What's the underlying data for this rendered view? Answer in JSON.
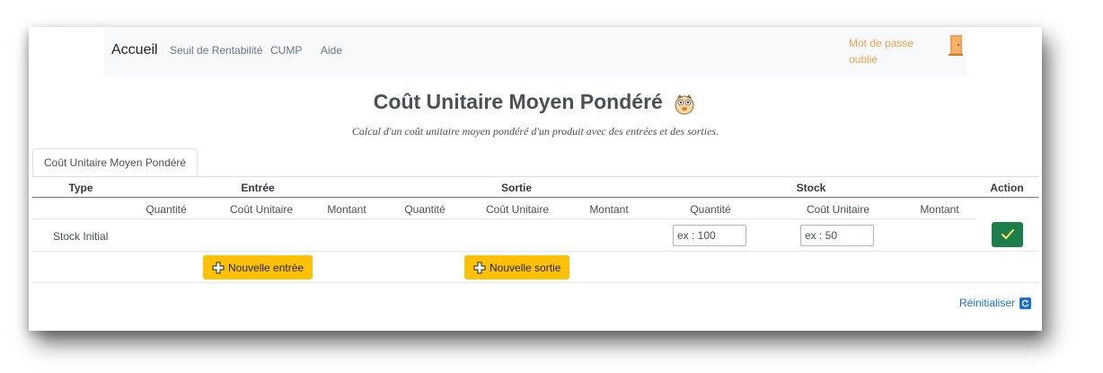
{
  "nav": {
    "brand": "Accueil",
    "links": [
      "Seuil de Rentabilité",
      "CUMP",
      "Aide"
    ],
    "forgot_password": "Mot de passe oublié"
  },
  "page": {
    "title": "Coût Unitaire Moyen Pondéré",
    "subtitle": "Calcul d'un coût unitaire moyen pondéré d'un produit avec des entrées et des sorties.",
    "tab": "Coût Unitaire Moyen Pondéré"
  },
  "table": {
    "groups": {
      "type": "Type",
      "entree": "Entrée",
      "sortie": "Sortie",
      "stock": "Stock",
      "action": "Action"
    },
    "subheaders": [
      "Quantité",
      "Coût Unitaire",
      "Montant",
      "Quantité",
      "Coût Unitaire",
      "Montant",
      "Quantité",
      "Coût Unitaire",
      "Montant"
    ],
    "row_label": "Stock Initial",
    "stock_qty_placeholder": "ex : 100",
    "stock_cu_placeholder": "ex : 50"
  },
  "buttons": {
    "new_entry": "Nouvelle entrée",
    "new_exit": "Nouvelle sortie",
    "reset": "Réinitialiser"
  },
  "colors": {
    "accent_yellow": "#ffc107",
    "success_green": "#1e7e4a",
    "link_blue": "#1a6fd0",
    "forgot_orange": "#f0a050"
  }
}
